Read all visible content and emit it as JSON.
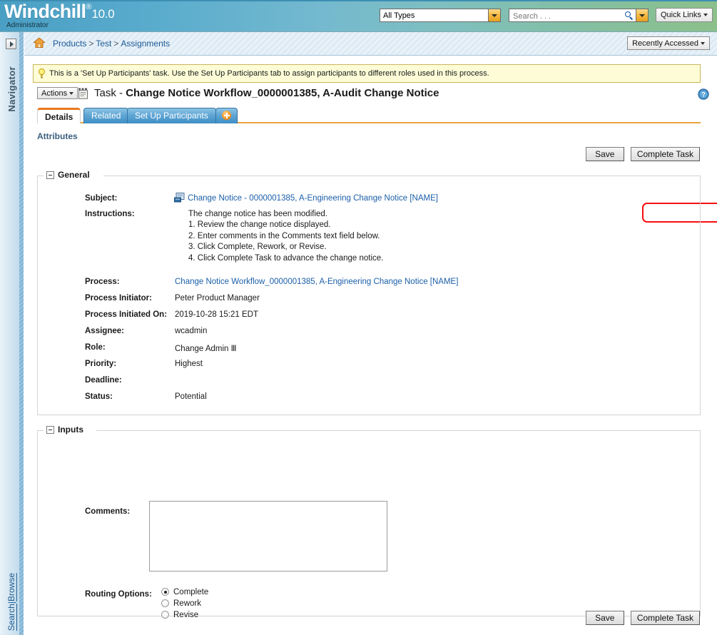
{
  "header": {
    "brand_name": "Windchill",
    "brand_registered": "®",
    "brand_version": "10.0",
    "user": "Administrator",
    "type_filter_value": "All Types",
    "search_placeholder": "Search . . .",
    "search_value": "",
    "quick_links_label": "Quick Links",
    "search_icon": "search-icon",
    "dropdown_icon": "chevron-down-icon"
  },
  "navigator": {
    "expand_icon": "expand-right-icon",
    "label": "Navigator",
    "search_link": "Search",
    "separator": "|",
    "browse_link": "Browse"
  },
  "breadcrumb": {
    "home_icon": "home-icon",
    "items": [
      {
        "label": "Products"
      },
      {
        "label": "Test"
      },
      {
        "label": "Assignments"
      }
    ],
    "separator": ">",
    "recently_accessed_label": "Recently Accessed"
  },
  "notice": {
    "icon": "lightbulb-icon",
    "text": "This is a 'Set Up Participants' task. Use the Set Up Participants tab to assign participants to different roles used in this process."
  },
  "page": {
    "actions_label": "Actions",
    "task_icon": "task-icon",
    "title_prefix": "Task - ",
    "title_main": "Change Notice Workflow_0000001385, A-Audit Change Notice",
    "help_icon": "help-icon",
    "section_label": "Attributes"
  },
  "tabs": [
    {
      "label": "Details",
      "active": true
    },
    {
      "label": "Related",
      "active": false
    },
    {
      "label": "Set Up Participants",
      "active": false
    },
    {
      "label": "",
      "active": false,
      "icon": "add-tab-icon"
    }
  ],
  "buttons": {
    "save_label": "Save",
    "complete_task_label": "Complete Task",
    "highlight_color": "#f50f0f"
  },
  "general": {
    "legend": "General",
    "subject_label": "Subject:",
    "subject_icon": "change-notice-icon",
    "subject_value": "Change Notice - 0000001385, A-Engineering Change Notice [NAME]",
    "instructions_label": "Instructions:",
    "instructions_lines": [
      "The change notice has been modified.",
      "1. Review the change notice displayed.",
      "2. Enter comments in the Comments text field below.",
      "3. Click Complete, Rework, or Revise.",
      "4. Click Complete Task to advance the change notice."
    ],
    "process_label": "Process:",
    "process_value": "Change Notice Workflow_0000001385, A-Engineering Change Notice [NAME]",
    "process_initiator_label": "Process Initiator:",
    "process_initiator_value": "Peter Product Manager",
    "process_initiated_on_label": "Process Initiated On:",
    "process_initiated_on_value": "2019-10-28 15:21 EDT",
    "assignee_label": "Assignee:",
    "assignee_value": "wcadmin",
    "role_label": "Role:",
    "role_value": "Change Admin Ⅲ",
    "priority_label": "Priority:",
    "priority_value": "Highest",
    "deadline_label": "Deadline:",
    "deadline_value": "",
    "status_label": "Status:",
    "status_value": "Potential"
  },
  "inputs": {
    "legend": "Inputs",
    "comments_label": "Comments:",
    "comments_value": "",
    "routing_options_label": "Routing Options:",
    "routing_options": [
      {
        "label": "Complete",
        "selected": true
      },
      {
        "label": "Rework",
        "selected": false
      },
      {
        "label": "Revise",
        "selected": false
      }
    ]
  }
}
